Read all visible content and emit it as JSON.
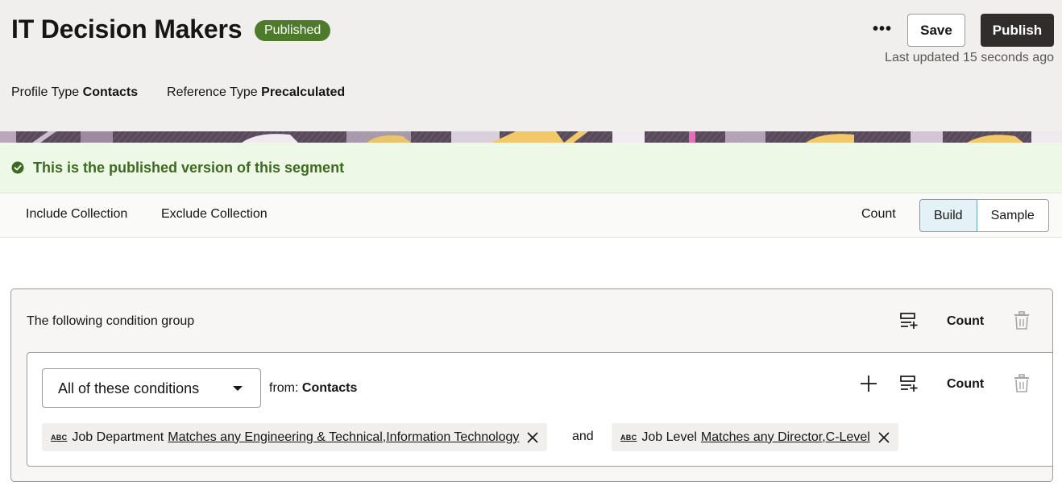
{
  "header": {
    "title": "IT Decision Makers",
    "status_badge": "Published",
    "more_label": "•••",
    "save_label": "Save",
    "publish_label": "Publish",
    "last_updated": "Last updated 15 seconds ago",
    "profile_type_label": "Profile Type",
    "profile_type_value": "Contacts",
    "reference_type_label": "Reference Type",
    "reference_type_value": "Precalculated"
  },
  "notice": {
    "text": "This is the published version of this segment",
    "color": "#3c6a1f"
  },
  "toolbar": {
    "include_label": "Include Collection",
    "exclude_label": "Exclude Collection",
    "count_label": "Count",
    "view_options": [
      "Build",
      "Sample"
    ],
    "active_view": "Build"
  },
  "group": {
    "title": "The following condition group",
    "count_label": "Count",
    "inner": {
      "match_mode": "All of these conditions",
      "from_label": "from:",
      "from_value": "Contacts",
      "count_label": "Count",
      "conditions": [
        {
          "type_icon": "ABC",
          "attribute": "Job Department",
          "rule": "Matches any Engineering & Technical,Information Technology"
        },
        {
          "type_icon": "ABC",
          "attribute": "Job Level",
          "rule": "Matches any Director,C-Level"
        }
      ],
      "joiner": "and"
    }
  },
  "colors": {
    "header_bg": "#f1efed",
    "badge_bg": "#4e7a2b",
    "publish_bg": "#312d2a",
    "notice_bg": "#eef8e7",
    "active_view_bg": "#e4f1f7"
  }
}
